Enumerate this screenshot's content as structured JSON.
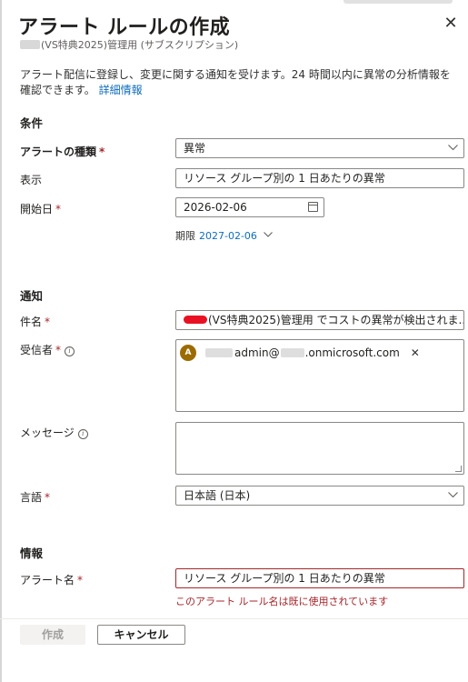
{
  "header": {
    "title": "アラート ルールの作成",
    "subtitle": "(VS特典2025)管理用 (サブスクリプション)",
    "close_label": "✕"
  },
  "description": {
    "text": "アラート配信に登録し、変更に関する通知を受けます。24 時間以内に異常の分析情報を確認できます。",
    "link": "詳細情報"
  },
  "conditions": {
    "section_title": "条件",
    "alert_type": {
      "label": "アラートの種類",
      "value": "異常"
    },
    "view": {
      "label": "表示",
      "value": "リソース グループ別の 1 日あたりの異常"
    },
    "start_date": {
      "label": "開始日",
      "value": "2026-02-06"
    },
    "expiration": {
      "label": "期限",
      "value": "2027-02-06"
    }
  },
  "notification": {
    "section_title": "通知",
    "subject": {
      "label": "件名",
      "value": "(VS特典2025)管理用 でコストの異常が検出されま..."
    },
    "recipients": {
      "label": "受信者",
      "chips": [
        {
          "avatar_initial": "A",
          "part1": "admin@",
          "part2": ".onmicrosoft.com"
        }
      ]
    },
    "message": {
      "label": "メッセージ",
      "value": ""
    },
    "language": {
      "label": "言語",
      "value": "日本語 (日本)"
    }
  },
  "info": {
    "section_title": "情報",
    "alert_name": {
      "label": "アラート名",
      "value": "リソース グループ別の 1 日あたりの異常",
      "error": "このアラート ルール名は既に使用されています"
    }
  },
  "footer": {
    "create_label": "作成",
    "cancel_label": "キャンセル"
  },
  "required_marker": "*",
  "colors": {
    "link": "#0f6cbd",
    "error": "#a4262c",
    "avatar": "#9c6b00"
  }
}
